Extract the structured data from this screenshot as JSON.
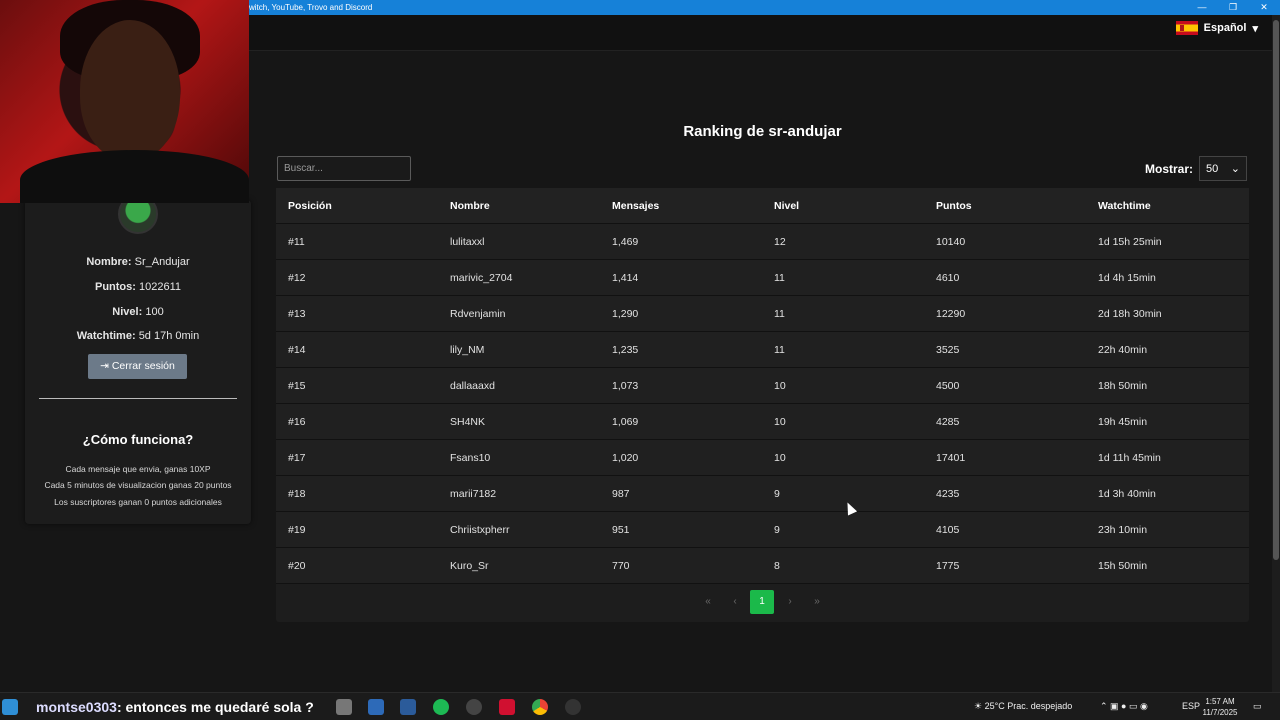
{
  "window": {
    "title": "witch, YouTube, Trovo and Discord",
    "controls": [
      "—",
      "❐",
      "✕"
    ]
  },
  "header": {
    "language": "Español"
  },
  "profile": {
    "name_label": "Nombre:",
    "name_value": "Sr_Andujar",
    "points_label": "Puntos:",
    "points_value": "1022611",
    "level_label": "Nivel:",
    "level_value": "100",
    "watchtime_label": "Watchtime:",
    "watchtime_value": "5d 17h 0min",
    "logout_label": "Cerrar sesión"
  },
  "how": {
    "title": "¿Cómo funciona?",
    "lines": [
      "Cada mensaje que envia, ganas 10XP",
      "Cada 5 minutos de visualizacion ganas 20 puntos",
      "Los suscriptores ganan 0 puntos adicionales"
    ]
  },
  "main": {
    "title": "Ranking de sr-andujar",
    "search_placeholder": "Buscar...",
    "show_label": "Mostrar:",
    "show_value": "50"
  },
  "table": {
    "headers": [
      "Posición",
      "Nombre",
      "Mensajes",
      "Nivel",
      "Puntos",
      "Watchtime"
    ],
    "rows": [
      [
        "#11",
        "lulitaxxl",
        "1,469",
        "12",
        "10140",
        "1d 15h 25min"
      ],
      [
        "#12",
        "marivic_2704",
        "1,414",
        "11",
        "4610",
        "1d 4h 15min"
      ],
      [
        "#13",
        "Rdvenjamin",
        "1,290",
        "11",
        "12290",
        "2d 18h 30min"
      ],
      [
        "#14",
        "lily_NM",
        "1,235",
        "11",
        "3525",
        "22h 40min"
      ],
      [
        "#15",
        "dallaaaxd",
        "1,073",
        "10",
        "4500",
        "18h 50min"
      ],
      [
        "#16",
        "SH4NK",
        "1,069",
        "10",
        "4285",
        "19h 45min"
      ],
      [
        "#17",
        "Fsans10",
        "1,020",
        "10",
        "17401",
        "1d 11h 45min"
      ],
      [
        "#18",
        "marii7182",
        "987",
        "9",
        "4235",
        "1d 3h 40min"
      ],
      [
        "#19",
        "Chriistxpherr",
        "951",
        "9",
        "4105",
        "23h 10min"
      ],
      [
        "#20",
        "Kuro_Sr",
        "770",
        "8",
        "1775",
        "15h 50min"
      ]
    ]
  },
  "pagination": {
    "first": "«",
    "prev": "‹",
    "current": "1",
    "next": "›",
    "last": "»"
  },
  "taskbar": {
    "chat_user": "montse0303",
    "chat_message": ": entonces me quedaré sola",
    "chat_tail": "?",
    "weather": "25°C  Prac. despejado",
    "lang": "ESP",
    "time": "1:57 AM",
    "date": "11/7/2025"
  },
  "colors": {
    "accent_green": "#1bb94a",
    "titlebar_blue": "#1681d8",
    "logout_button": "#6c7a89"
  }
}
